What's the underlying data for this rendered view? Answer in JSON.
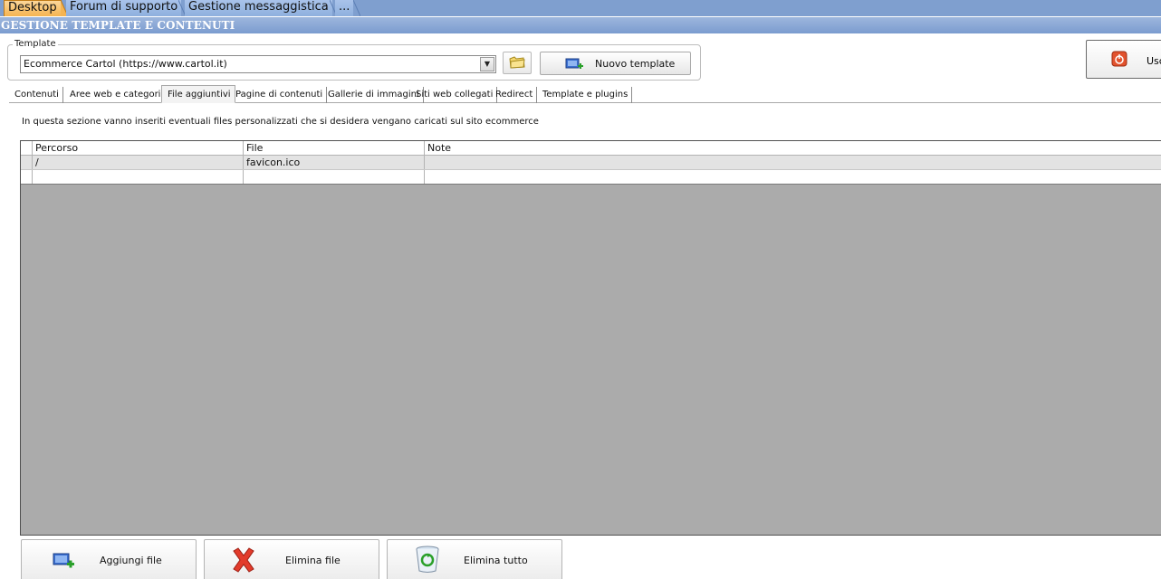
{
  "top_tabs": [
    {
      "label": "Desktop"
    },
    {
      "label": "Forum di supporto"
    },
    {
      "label": "Gestione messaggistica"
    },
    {
      "label": "..."
    }
  ],
  "section_title": "GESTIONE TEMPLATE E CONTENUTI",
  "template_group": {
    "title": "Template",
    "selected_value": "Ecommerce Cartol (https://www.cartol.it)",
    "new_template_label": "Nuovo template"
  },
  "exit_button": {
    "label": "Usc"
  },
  "sub_tabs": [
    {
      "label": "Contenuti"
    },
    {
      "label": "Aree web e categorie"
    },
    {
      "label": "File aggiuntivi"
    },
    {
      "label": "Pagine di contenuti"
    },
    {
      "label": "Gallerie di immagini"
    },
    {
      "label": "Siti web collegati"
    },
    {
      "label": "Redirect"
    },
    {
      "label": "Template e plugins"
    }
  ],
  "active_sub_tab": "File aggiuntivi",
  "info_text": "In questa sezione vanno inseriti eventuali files personalizzati che si desidera vengano caricati sul sito ecommerce",
  "grid": {
    "columns": [
      "Percorso",
      "File",
      "Note"
    ],
    "rows": [
      {
        "path": "/",
        "file": "favicon.ico",
        "note": ""
      },
      {
        "path": "",
        "file": "",
        "note": ""
      }
    ]
  },
  "buttons": {
    "add_file": "Aggiungi file",
    "delete_file": "Elimina file",
    "delete_all": "Elimina tutto"
  },
  "colors": {
    "active_tab": "#f5b451",
    "header_blue": "#7b9ccf",
    "grid_background": "#ababab"
  },
  "icons": {
    "folder": "folder-icon",
    "add_template": "add-template-icon",
    "exit": "power-icon",
    "add_file": "add-file-icon",
    "delete_file": "red-x-icon",
    "delete_all": "recycle-bin-icon"
  }
}
